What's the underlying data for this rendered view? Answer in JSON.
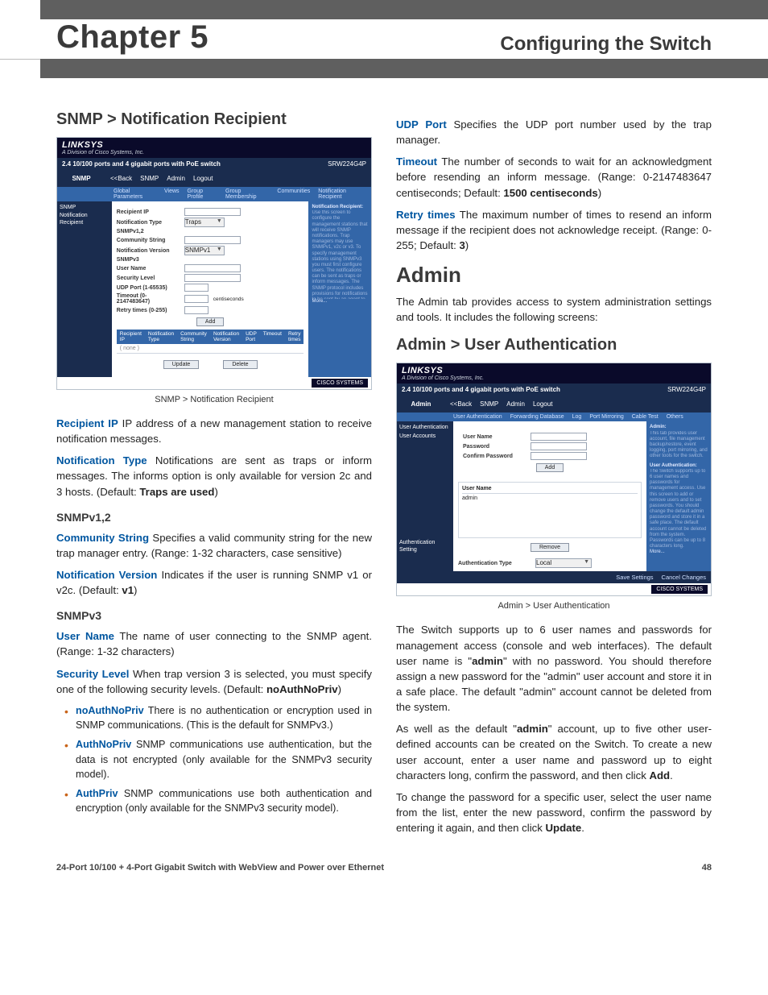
{
  "header": {
    "chapter": "Chapter 5",
    "section": "Configuring the Switch"
  },
  "left": {
    "h_snmp": "SNMP > Notification Recipient",
    "caption1": "SNMP > Notification Recipient",
    "p_recipient_ip_term": "Recipient IP",
    "p_recipient_ip": "  IP address of a new management station to receive notification messages.",
    "p_notif_type_term": "Notification Type",
    "p_notif_type": "  Notifications are sent as traps or inform messages. The informs option is only available for version 2c and 3 hosts. (Default: ",
    "p_notif_type_bold": "Traps are used",
    "p_notif_type_end": ")",
    "h_v12": "SNMPv1,2",
    "p_comm_term": "Community String",
    "p_comm": "  Specifies a valid community string for the new trap manager entry. (Range: 1-32 characters, case sensitive)",
    "p_nver_term": "Notification Version",
    "p_nver": "  Indicates if the user is running SNMP v1 or v2c. (Default: ",
    "p_nver_bold": "v1",
    "p_nver_end": ")",
    "h_v3": "SNMPv3",
    "p_user_term": "User Name",
    "p_user": "  The name of user connecting to the SNMP agent. (Range: 1-32 characters)",
    "p_sec_term": "Security Level",
    "p_sec": "  When trap version 3 is selected, you must specify one of the following security levels. (Default: ",
    "p_sec_bold": "noAuthNoPriv",
    "p_sec_end": ")",
    "bullets": [
      {
        "term": "noAuthNoPriv",
        "txt": "  There is no authentication or encryption used in SNMP communications. (This is the default for SNMPv3.)"
      },
      {
        "term": "AuthNoPriv",
        "txt": "  SNMP communications use authentication, but the data is not encrypted (only available for the SNMPv3 security model)."
      },
      {
        "term": "AuthPriv",
        "txt": "  SNMP communications use both authentication and encryption (only available for the SNMPv3 security model)."
      }
    ]
  },
  "right": {
    "p_udp_term": "UDP Port",
    "p_udp": "  Specifies the UDP port number used by the trap manager.",
    "p_timeout_term": "Timeout",
    "p_timeout": "  The number of seconds to wait for an acknowledgment before resending an inform message. (Range: 0-2147483647 centiseconds; Default: ",
    "p_timeout_bold": "1500 centiseconds",
    "p_timeout_end": ")",
    "p_retry_term": "Retry times",
    "p_retry": "  The maximum number of times to resend an inform message if the recipient does not acknowledge receipt. (Range: 0-255; Default: ",
    "p_retry_bold": "3",
    "p_retry_end": ")",
    "h_admin": "Admin",
    "p_admin_intro": "The Admin tab provides access to system administration settings and tools. It includes the following screens:",
    "h_userauth": "Admin > User Authentication",
    "caption2": "Admin > User Authentication",
    "p_switch1a": "The Switch supports up to 6 user names and passwords for management access (console and web interfaces). The default user name is \"",
    "p_switch1_bold": "admin",
    "p_switch1b": "\" with no password. You should therefore assign a new password for the \"admin\" user account and store it in a safe place. The default \"admin\" account cannot be deleted from the system.",
    "p_switch2a": "As well as the default \"",
    "p_switch2_bold": "admin",
    "p_switch2b": "\" account, up to five other user-defined accounts can be created on the Switch. To create a new user account, enter a user name and password up to eight characters long, confirm the password, and then click ",
    "p_switch2_bold2": "Add",
    "p_switch2c": ".",
    "p_switch3a": "To change the password for a specific user, select the user name from the list, enter the new password, confirm the password by entering it again, and then click ",
    "p_switch3_bold": "Update",
    "p_switch3b": "."
  },
  "mock1": {
    "logo": "LINKSYS",
    "sublogo": "A Division of Cisco Systems, Inc.",
    "top_right1": "2.4 10/100 ports and 4 gigabit ports with PoE switch",
    "top_right2": "SRW224G4P",
    "side": "SNMP",
    "tabs": [
      "<<Back",
      "SNMP",
      "Admin",
      "Logout"
    ],
    "subtabs": [
      "Global Parameters",
      "Views",
      "Group Profile",
      "Group Membership",
      "Communities",
      "Notification Recipient"
    ],
    "left": [
      "SNMP",
      "Notification Recipient"
    ],
    "fields": [
      "Recipient IP",
      "Notification Type",
      "SNMPv1,2",
      "Community String",
      "Notification Version",
      "SNMPv3",
      "User Name",
      "Security Level",
      "UDP Port (1-65535)",
      "Timeout (0-2147483647)",
      "Retry times (0-255)"
    ],
    "ntype_val": "Traps",
    "nver_val": "SNMPv1",
    "timeout_unit": "centiseconds",
    "add": "Add",
    "tbl": [
      "Recipient IP",
      "Notification Type",
      "Community String",
      "Notification Version",
      "UDP Port",
      "Timeout",
      "Retry times"
    ],
    "footer_btns": [
      "Update",
      "Delete"
    ],
    "help_title": "Notification Recipient:",
    "help_more": "More...",
    "badge": "CISCO SYSTEMS"
  },
  "mock2": {
    "logo": "LINKSYS",
    "sublogo": "A Division of Cisco Systems, Inc.",
    "top_right1": "2.4 10/100 ports and 4 gigabit ports with PoE switch",
    "top_right2": "SRW224G4P",
    "side": "Admin",
    "tabs": [
      "<<Back",
      "SNMP",
      "Admin",
      "Logout"
    ],
    "subtabs": [
      "User Authentication",
      "Forwarding Database",
      "Log",
      "Port Mirroring",
      "Cable Test",
      "Others"
    ],
    "left": [
      "User Authentication",
      "User Accounts",
      "",
      "",
      "",
      "",
      "Authentication Setting"
    ],
    "fields": [
      "User Name",
      "Password",
      "Confirm Password"
    ],
    "add": "Add",
    "list_hdr": "User Name",
    "list_item": "admin",
    "auth_label": "Authentication Type",
    "auth_val": "Local",
    "remove": "Remove",
    "save": "Save Settings",
    "cancel": "Cancel Changes",
    "help_title": "Admin:",
    "help_sub": "User Authentication:",
    "help_more": "More...",
    "badge": "CISCO SYSTEMS"
  },
  "footer": {
    "left": "24-Port 10/100 + 4-Port Gigabit Switch with WebView and Power over Ethernet",
    "right": "48"
  }
}
